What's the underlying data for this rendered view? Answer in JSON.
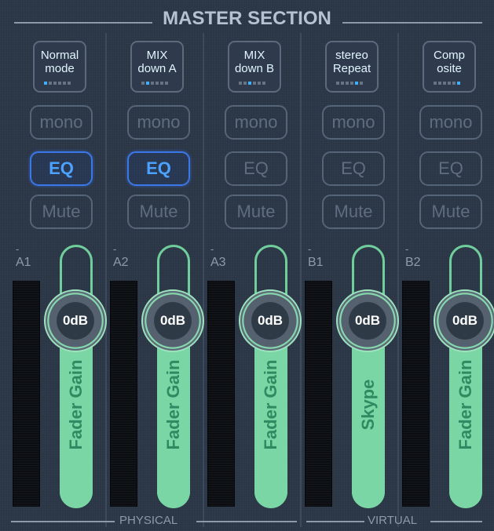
{
  "header": {
    "title": "MASTER SECTION"
  },
  "footer": {
    "physical_label": "PHYSICAL",
    "virtual_label": "VIRTUAL"
  },
  "strips": [
    {
      "mode_line1": "Normal",
      "mode_line2": "mode",
      "mode_index": 0,
      "mono": "mono",
      "eq": "EQ",
      "eq_active": true,
      "mute": "Mute",
      "bus": "A1",
      "gain": "0dB",
      "fader_name": "Fader Gain"
    },
    {
      "mode_line1": "MIX",
      "mode_line2": "down A",
      "mode_index": 1,
      "mono": "mono",
      "eq": "EQ",
      "eq_active": true,
      "mute": "Mute",
      "bus": "A2",
      "gain": "0dB",
      "fader_name": "Fader Gain"
    },
    {
      "mode_line1": "MIX",
      "mode_line2": "down B",
      "mode_index": 2,
      "mono": "mono",
      "eq": "EQ",
      "eq_active": false,
      "mute": "Mute",
      "bus": "A3",
      "gain": "0dB",
      "fader_name": "Fader Gain"
    },
    {
      "mode_line1": "stereo",
      "mode_line2": "Repeat",
      "mode_index": 4,
      "mono": "mono",
      "eq": "EQ",
      "eq_active": false,
      "mute": "Mute",
      "bus": "B1",
      "gain": "0dB",
      "fader_name": "Skype"
    },
    {
      "mode_line1": "Comp",
      "mode_line2": "osite",
      "mode_index": 5,
      "mono": "mono",
      "eq": "EQ",
      "eq_active": false,
      "mute": "Mute",
      "bus": "B2",
      "gain": "0dB",
      "fader_name": "Fader Gain"
    }
  ],
  "colors": {
    "background": "#2a3545",
    "eq_active": "#3b78e7",
    "fader": "#7ad6a4",
    "mode_indicator": "#3fb0ff"
  }
}
